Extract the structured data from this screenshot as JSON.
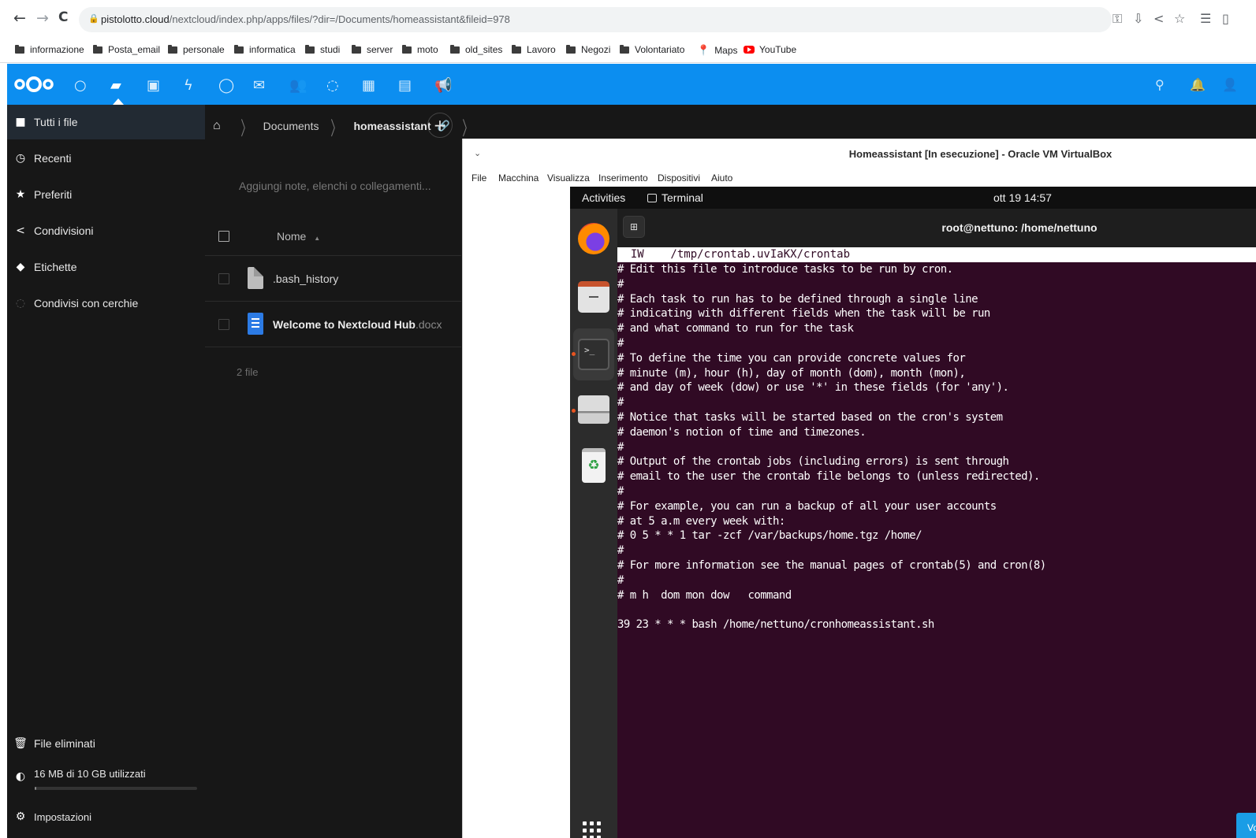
{
  "browser": {
    "url_domain": "pistolotto.cloud",
    "url_path": "/nextcloud/index.php/apps/files/?dir=/Documents/homeassistant&fileid=978",
    "nav": {
      "back": "←",
      "forward": "→",
      "reload": "C"
    },
    "toolbar_icons": [
      "key-icon",
      "install-icon",
      "share-icon",
      "star-icon",
      "reading-list-icon",
      "side-panel-icon"
    ],
    "bookmarks": [
      {
        "label": "informazione",
        "icon": "folder"
      },
      {
        "label": "Posta_email",
        "icon": "folder"
      },
      {
        "label": "personale",
        "icon": "folder"
      },
      {
        "label": "informatica",
        "icon": "folder"
      },
      {
        "label": "studi",
        "icon": "folder"
      },
      {
        "label": "server",
        "icon": "folder"
      },
      {
        "label": "moto",
        "icon": "folder"
      },
      {
        "label": "old_sites",
        "icon": "folder"
      },
      {
        "label": "Lavoro",
        "icon": "folder"
      },
      {
        "label": "Negozi",
        "icon": "folder"
      },
      {
        "label": "Volontariato",
        "icon": "folder"
      },
      {
        "label": "Maps",
        "icon": "maps-pin"
      },
      {
        "label": "YouTube",
        "icon": "youtube"
      }
    ]
  },
  "nextcloud": {
    "header_color": "#0c8ef0",
    "apps": [
      "dashboard-icon",
      "files-icon",
      "photos-icon",
      "activity-icon",
      "talk-icon",
      "mail-icon",
      "contacts-icon",
      "circles-icon",
      "calendar-icon",
      "deck-icon",
      "announcements-icon"
    ],
    "sidebar": {
      "items": [
        {
          "label": "Tutti i file",
          "icon": "folder-icon"
        },
        {
          "label": "Recenti",
          "icon": "clock-icon"
        },
        {
          "label": "Preferiti",
          "icon": "star-icon"
        },
        {
          "label": "Condivisioni",
          "icon": "share-icon"
        },
        {
          "label": "Etichette",
          "icon": "tag-icon"
        },
        {
          "label": "Condivisi con cerchie",
          "icon": "circles-icon"
        }
      ],
      "deleted": "File eliminati",
      "quota": "16 MB di 10 GB utilizzati",
      "quota_fraction": 0.0016,
      "settings": "Impostazioni"
    },
    "breadcrumb": {
      "home": "⌂",
      "folder": "Documents",
      "current": "homeassistant"
    },
    "notes_placeholder": "Aggiungi note, elenchi o collegamenti...",
    "list_header": "Nome",
    "files": [
      {
        "name": ".bash_history",
        "ext": "",
        "type": "generic"
      },
      {
        "name": "Welcome to Nextcloud Hub",
        "ext": ".docx",
        "type": "document"
      }
    ],
    "file_count": "2 file"
  },
  "vbox": {
    "title": "Homeassistant [In esecuzione] - Oracle VM VirtualBox",
    "menu": [
      "File",
      "Macchina",
      "Visualizza",
      "Inserimento",
      "Dispositivi",
      "Aiuto"
    ]
  },
  "ubuntu": {
    "activities": "Activities",
    "app_name": "Terminal",
    "clock": "ott 19  14:57",
    "terminal_title": "root@nettuno: /home/nettuno",
    "nano_header": "  IW    /tmp/crontab.uvIaKX/crontab",
    "lines": [
      "# Edit this file to introduce tasks to be run by cron.",
      "#",
      "# Each task to run has to be defined through a single line",
      "# indicating with different fields when the task will be run",
      "# and what command to run for the task",
      "#",
      "# To define the time you can provide concrete values for",
      "# minute (m), hour (h), day of month (dom), month (mon),",
      "# and day of week (dow) or use '*' in these fields (for 'any').",
      "#",
      "# Notice that tasks will be started based on the cron's system",
      "# daemon's notion of time and timezones.",
      "#",
      "# Output of the crontab jobs (including errors) is sent through",
      "# email to the user the crontab file belongs to (unless redirected).",
      "#",
      "# For example, you can run a backup of all your user accounts",
      "# at 5 a.m every week with:",
      "# 0 5 * * 1 tar -zcf /var/backups/home.tgz /home/",
      "#",
      "# For more information see the manual pages of crontab(5) and cron(8)",
      "#",
      "# m h  dom mon dow   command",
      "",
      "39 23 * * * bash /home/nettuno/cronhomeassistant.sh"
    ],
    "volume_tooltip": "Volume"
  }
}
